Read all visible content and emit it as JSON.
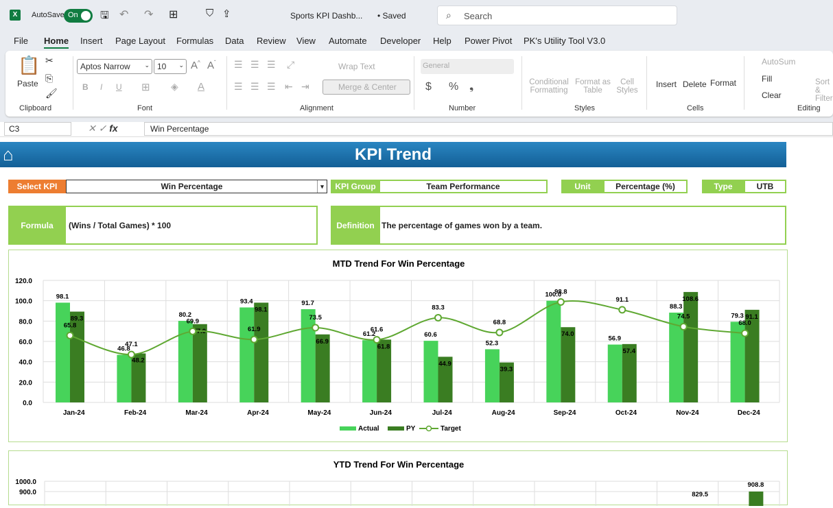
{
  "titlebar": {
    "autosave_label": "AutoSave",
    "autosave_state": "On",
    "filename": "Sports KPI Dashb...",
    "saved": "• Saved",
    "search_placeholder": "Search"
  },
  "menu": [
    "File",
    "Home",
    "Insert",
    "Page Layout",
    "Formulas",
    "Data",
    "Review",
    "View",
    "Automate",
    "Developer",
    "Help",
    "Power Pivot",
    "PK's Utility Tool V3.0"
  ],
  "ribbon": {
    "paste": "Paste",
    "clipboard": "Clipboard",
    "font_name": "Aptos Narrow",
    "font_size": "10",
    "font": "Font",
    "wrap_text": "Wrap Text",
    "merge_center": "Merge & Center",
    "alignment": "Alignment",
    "number_format": "General",
    "number": "Number",
    "conditional_formatting": "Conditional Formatting",
    "format_as_table": "Format as Table",
    "cell_styles": "Cell Styles",
    "styles": "Styles",
    "insert": "Insert",
    "delete": "Delete",
    "format": "Format",
    "cells": "Cells",
    "autosum": "AutoSum",
    "fill": "Fill",
    "clear": "Clear",
    "sort_filter": "Sort & Filter",
    "editing": "Editing"
  },
  "formula_bar": {
    "cell_ref": "C3",
    "content": "Win Percentage"
  },
  "dashboard": {
    "title": "KPI Trend",
    "select_kpi_label": "Select KPI",
    "select_kpi_value": "Win Percentage",
    "kpi_group_label": "KPI Group",
    "kpi_group_value": "Team Performance",
    "unit_label": "Unit",
    "unit_value": "Percentage (%)",
    "type_label": "Type",
    "type_value": "UTB",
    "formula_label": "Formula",
    "formula_value": "(Wins / Total Games) * 100",
    "definition_label": "Definition",
    "definition_value": "The percentage of games won by a team."
  },
  "colors": {
    "actual": "#47D35A",
    "py": "#3A7D22",
    "target": "#5FA832",
    "label_green": "#92D050",
    "select_orange": "#ED7D31"
  },
  "chart_data": [
    {
      "type": "bar",
      "title": "MTD Trend For Win Percentage",
      "categories": [
        "Jan-24",
        "Feb-24",
        "Mar-24",
        "Apr-24",
        "May-24",
        "Jun-24",
        "Jul-24",
        "Aug-24",
        "Sep-24",
        "Oct-24",
        "Nov-24",
        "Dec-24"
      ],
      "series": [
        {
          "name": "Actual",
          "type": "bar",
          "values": [
            98.1,
            46.8,
            80.2,
            93.4,
            91.7,
            61.2,
            60.6,
            52.3,
            100.0,
            56.9,
            88.3,
            79.3
          ]
        },
        {
          "name": "PY",
          "type": "bar",
          "values": [
            89.3,
            48.2,
            77.0,
            98.1,
            66.9,
            61.8,
            44.9,
            39.3,
            74.0,
            57.4,
            108.6,
            91.1
          ]
        },
        {
          "name": "Target",
          "type": "line",
          "values": [
            65.8,
            47.1,
            69.9,
            61.9,
            73.5,
            61.6,
            83.3,
            68.8,
            98.8,
            91.1,
            74.5,
            68.0
          ]
        }
      ],
      "ylim": [
        0,
        120
      ],
      "yticks": [
        "0.0",
        "20.0",
        "40.0",
        "60.0",
        "80.0",
        "100.0",
        "120.0"
      ],
      "grid": true,
      "legend": "bottom"
    },
    {
      "type": "bar",
      "title": "YTD Trend For Win Percentage",
      "yticks_visible": [
        "1000.0",
        "900.0"
      ],
      "visible_labels": {
        "Nov-24": "829.5",
        "Dec-24": "908.8"
      },
      "grid": true
    }
  ]
}
